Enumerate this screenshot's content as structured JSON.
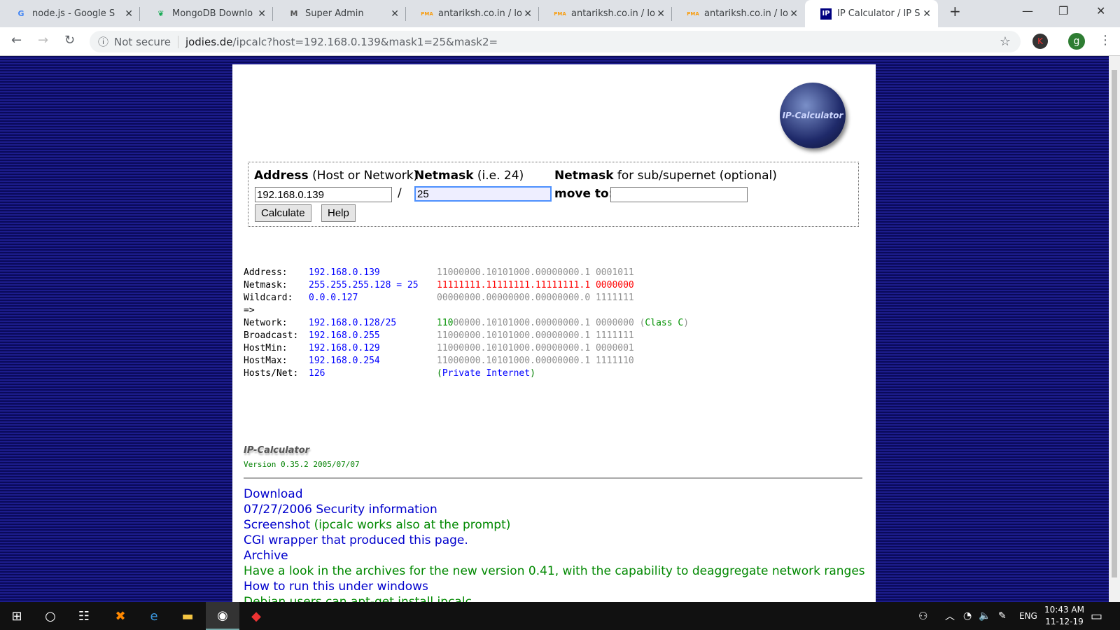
{
  "tabs": [
    {
      "title": "node.js - Google S",
      "icon": "G",
      "color": "#4285f4"
    },
    {
      "title": "MongoDB Downlo",
      "icon": "❦",
      "color": "#13aa52"
    },
    {
      "title": "Super Admin",
      "icon": "M",
      "color": "#555"
    },
    {
      "title": "antariksh.co.in / lo",
      "icon": "PMA",
      "color": "#f89c0e"
    },
    {
      "title": "antariksh.co.in / lo",
      "icon": "PMA",
      "color": "#f89c0e"
    },
    {
      "title": "antariksh.co.in / lo",
      "icon": "PMA",
      "color": "#f89c0e"
    },
    {
      "title": "IP Calculator / IP S",
      "icon": "IP",
      "color": "#000080"
    }
  ],
  "address": {
    "security": "Not secure",
    "domain": "jodies.de",
    "path": "/ipcalc?host=192.168.0.139&mask1=25&mask2="
  },
  "profile": {
    "k": "K",
    "g": "g"
  },
  "logo_text": "IP-Calculator",
  "form": {
    "address_label": "Address",
    "address_hint": "(Host or Network)",
    "netmask_label": "Netmask",
    "netmask_hint": "(i.e. 24)",
    "netmask2_label": "Netmask",
    "netmask2_hint": "for sub/supernet (optional)",
    "slash": "/",
    "move_to": "move to:",
    "address_value": "192.168.0.139",
    "netmask_value": "25",
    "netmask2_value": "",
    "calculate": "Calculate",
    "help": "Help"
  },
  "results": [
    {
      "label": "Address:",
      "value": "192.168.0.139",
      "binary": "11000000.10101000.00000000.1 0001011"
    },
    {
      "label": "Netmask:",
      "value": "255.255.255.128 = 25",
      "binary": "11111111.11111111.11111111.1 0000000"
    },
    {
      "label": "Wildcard:",
      "value": "0.0.0.127",
      "binary": "00000000.00000000.00000000.0 1111111"
    },
    {
      "label": "=>",
      "value": "",
      "binary": ""
    },
    {
      "label": "Network:",
      "value": "192.168.0.128/25",
      "binary_class_bits": "110",
      "binary": "00000.10101000.00000000.1 0000000",
      "class": "Class C"
    },
    {
      "label": "Broadcast:",
      "value": "192.168.0.255",
      "binary": "11000000.10101000.00000000.1 1111111"
    },
    {
      "label": "HostMin:",
      "value": "192.168.0.129",
      "binary": "11000000.10101000.00000000.1 0000001"
    },
    {
      "label": "HostMax:",
      "value": "192.168.0.254",
      "binary": "11000000.10101000.00000000.1 1111110"
    },
    {
      "label": "Hosts/Net:",
      "value": "126",
      "note": "Private Internet"
    }
  ],
  "footer": {
    "logo": "IP-Calculator",
    "version": "Version 0.35.2 2005/07/07"
  },
  "links": {
    "download": "Download",
    "security": "07/27/2006 Security information",
    "screenshot": "Screenshot",
    "screenshot_note": "(ipcalc works also at the prompt)",
    "cgi": "CGI wrapper that produced this page.",
    "archive": "Archive",
    "archive_note_pre": "Have a look in the archives for the ",
    "archive_note_bold": "new version 0.41",
    "archive_note_post": ", with the capability to deaggregate network ranges",
    "windows": "How to run this under windows",
    "debian": "Debian users can apt-get install ipcalc"
  },
  "tray": {
    "lang": "ENG",
    "time": "10:43 AM",
    "date": "11-12-19"
  }
}
